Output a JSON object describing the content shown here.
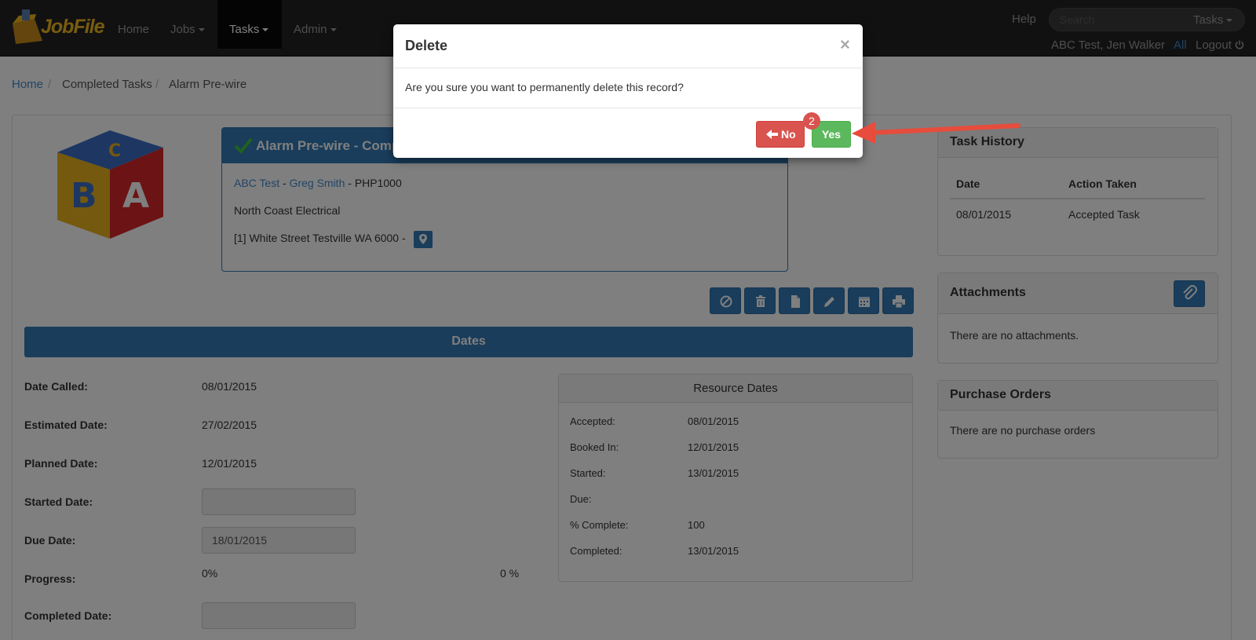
{
  "navbar": {
    "logo_text": "JobFile",
    "items": [
      {
        "label": "Home",
        "dropdown": false
      },
      {
        "label": "Jobs",
        "dropdown": true
      },
      {
        "label": "Tasks",
        "dropdown": true,
        "active": true
      },
      {
        "label": "Admin",
        "dropdown": true
      }
    ],
    "help": "Help",
    "search_placeholder": "Search",
    "search_category": "Tasks",
    "user": "ABC Test, Jen Walker",
    "all": "All",
    "logout": "Logout"
  },
  "breadcrumb": [
    "Home",
    "Completed Tasks",
    "Alarm Pre-wire"
  ],
  "task": {
    "title": "Alarm Pre-wire - Comp",
    "client": "ABC Test",
    "contact": "Greg Smith",
    "code": "- PHP1000",
    "company": "North Coast Electrical",
    "address": "[1] White Street Testville WA 6000 -"
  },
  "toolbar_icons": [
    "ban-icon",
    "trash-icon",
    "file-icon",
    "pencil-icon",
    "calendar-icon",
    "print-icon"
  ],
  "dates": {
    "title": "Dates",
    "date_called_label": "Date Called:",
    "date_called": "08/01/2015",
    "estimated_label": "Estimated Date:",
    "estimated": "27/02/2015",
    "planned_label": "Planned Date:",
    "planned": "12/01/2015",
    "started_label": "Started Date:",
    "started": "",
    "due_label": "Due Date:",
    "due": "18/01/2015",
    "progress_label": "Progress:",
    "progress_left": "0%",
    "progress_right": "0 %",
    "completed_label": "Completed Date:",
    "completed": ""
  },
  "resource_dates": {
    "title": "Resource Dates",
    "rows": [
      {
        "label": "Accepted:",
        "value": "08/01/2015"
      },
      {
        "label": "Booked In:",
        "value": "12/01/2015"
      },
      {
        "label": "Started:",
        "value": "13/01/2015"
      },
      {
        "label": "Due:",
        "value": ""
      },
      {
        "label": "% Complete:",
        "value": "100"
      },
      {
        "label": "Completed:",
        "value": "13/01/2015"
      }
    ]
  },
  "task_history": {
    "title": "Task History",
    "col_date": "Date",
    "col_action": "Action Taken",
    "rows": [
      {
        "date": "08/01/2015",
        "action": "Accepted Task"
      }
    ]
  },
  "attachments": {
    "title": "Attachments",
    "empty": "There are no attachments."
  },
  "purchase_orders": {
    "title": "Purchase Orders",
    "empty": "There are no purchase orders"
  },
  "modal": {
    "title": "Delete",
    "close": "×",
    "message": "Are you sure you want to permanently delete this record?",
    "no_label": "No",
    "yes_label": "Yes",
    "step_badge": "2"
  },
  "colors": {
    "primary": "#337ab7",
    "danger": "#d9534f",
    "success": "#5cb85c",
    "arrow": "#e74c3c"
  }
}
